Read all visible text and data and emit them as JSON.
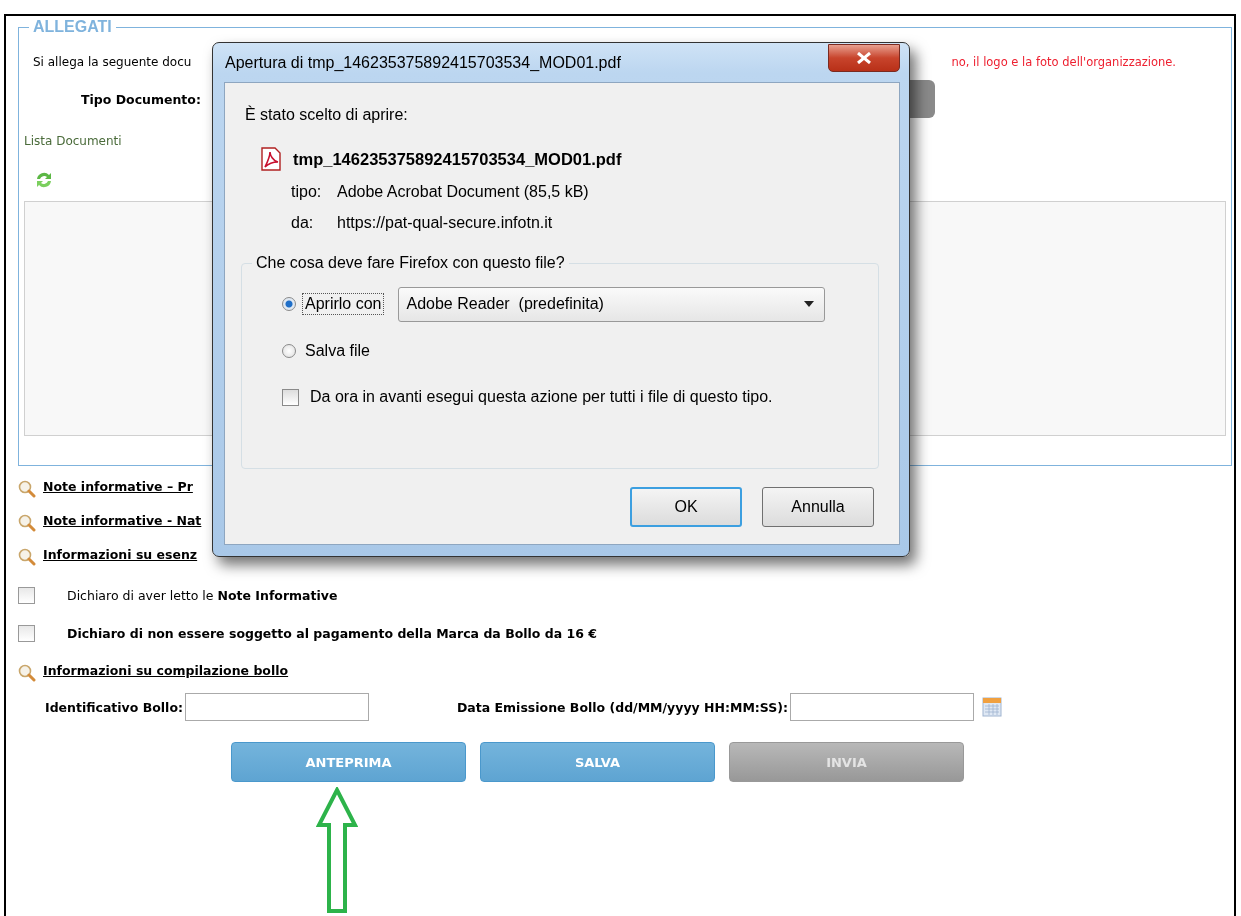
{
  "page": {
    "section_title": "ALLEGATI",
    "intro_text": "Si allega la seguente docu",
    "notice_text": "no, il logo e la foto dell'organizzazione.",
    "doc_type_label": "Tipo Documento:",
    "list_label": "Lista Documenti",
    "info_links": [
      "Note informative – Pr",
      "Note informative - Nat",
      "Informazioni su esenz"
    ],
    "declarations": [
      {
        "text": "Dichiaro di aver letto le **Note Informative**",
        "bold": false,
        "checked": false
      },
      {
        "text": "Dichiaro di non essere soggetto al pagamento della Marca da Bollo da 16 €",
        "bold": true,
        "checked": false
      }
    ],
    "bollo_link": "Informazioni su compilazione bollo",
    "fields": [
      {
        "label": "Identificativo Bollo:",
        "kind": "text"
      },
      {
        "label": "Data Emissione Bollo (dd/MM/yyyy HH:MM:SS):",
        "kind": "date"
      }
    ],
    "buttons": [
      {
        "label": "ANTEPRIMA",
        "disabled": false
      },
      {
        "label": "SALVA",
        "disabled": false
      },
      {
        "label": "INVIA",
        "disabled": true
      }
    ]
  },
  "dialog": {
    "title": "Apertura di tmp_146235375892415703534_MOD01.pdf",
    "intro": "È stato scelto di aprire:",
    "file_name": "tmp_146235375892415703534_MOD01.pdf",
    "details": [
      {
        "label": "tipo:",
        "value": "Adobe Acrobat Document (85,5 kB)"
      },
      {
        "label": "da:",
        "value": "https://pat-qual-secure.infotn.it"
      }
    ],
    "group_title": "Che cosa deve fare Firefox con questo file?",
    "options": [
      {
        "label": "Aprirlo con",
        "selected": true,
        "app": "Adobe Reader  (predefinita)"
      },
      {
        "label": "Salva file",
        "selected": false
      }
    ],
    "remember": {
      "label": "Da ora in avanti esegui questa azione per tutti i file di questo tipo.",
      "checked": false
    },
    "buttons": [
      {
        "label": "OK",
        "focused": true
      },
      {
        "label": "Annulla",
        "focused": false
      }
    ]
  }
}
